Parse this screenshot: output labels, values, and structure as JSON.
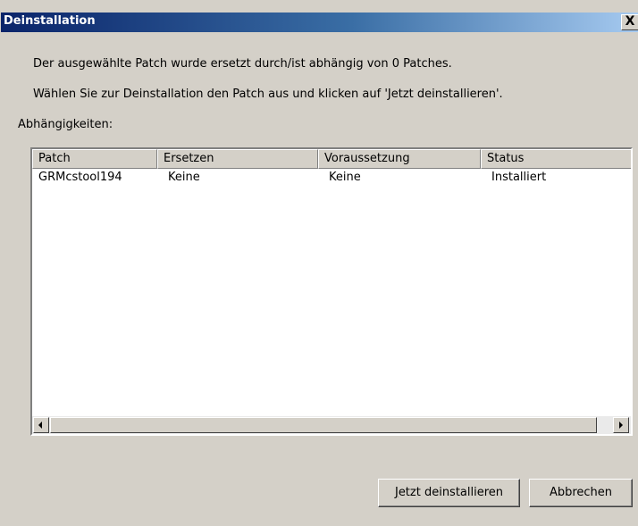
{
  "window": {
    "title": "Deinstallation",
    "close_label": "X"
  },
  "info": {
    "line1": "Der ausgewählte Patch wurde ersetzt durch/ist abhängig von 0 Patches.",
    "line2": "Wählen Sie zur Deinstallation den Patch aus und klicken auf 'Jetzt deinstallieren'.",
    "dependencies_label": "Abhängigkeiten:"
  },
  "table": {
    "columns": [
      "Patch",
      "Ersetzen",
      "Voraussetzung",
      "Status"
    ],
    "rows": [
      [
        "GRMcstool194",
        "Keine",
        "Keine",
        "Installiert"
      ]
    ]
  },
  "buttons": {
    "uninstall_accel": "J",
    "uninstall_rest": "etzt deinstallieren",
    "cancel": "Abbrechen"
  },
  "icons": {
    "close": "close-icon",
    "scroll_left": "arrow-left-icon",
    "scroll_right": "arrow-right-icon"
  }
}
